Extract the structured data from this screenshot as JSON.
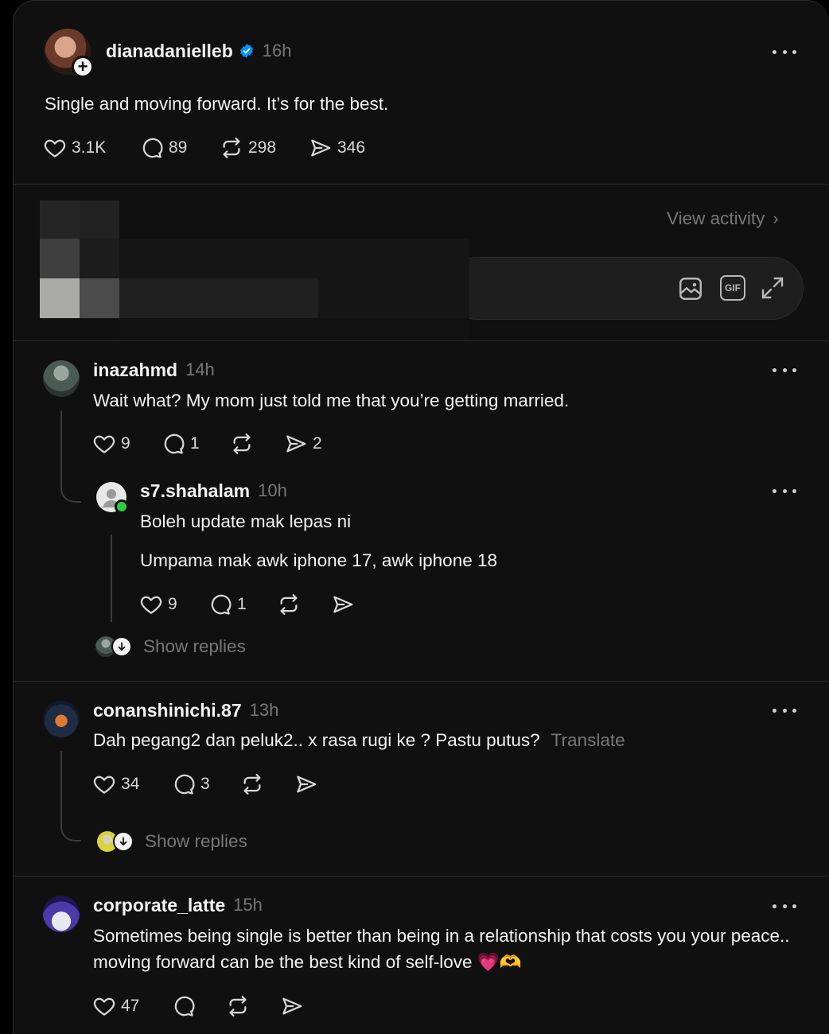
{
  "post": {
    "username": "dianadanielleb",
    "time": "16h",
    "verified": true,
    "text": "Single and moving forward. It’s for the best.",
    "likes": "3.1K",
    "comments": "89",
    "reposts": "298",
    "shares": "346"
  },
  "activity": {
    "view_label": "View activity"
  },
  "composer": {
    "image_icon": "image-icon",
    "gif_label": "GIF",
    "expand_icon": "expand-icon"
  },
  "comments": [
    {
      "username": "inazahmd",
      "time": "14h",
      "text": "Wait what? My mom just told me that you’re getting married.",
      "likes": "9",
      "replies": "1",
      "shares": "2"
    },
    {
      "username": "conanshinichi.87",
      "time": "13h",
      "text": "Dah pegang2 dan peluk2.. x rasa rugi ke ? Pastu putus?",
      "translate": "Translate",
      "likes": "34",
      "replies": "3",
      "show_replies": "Show replies"
    },
    {
      "username": "corporate_latte",
      "time": "15h",
      "text": "Sometimes being single is better than being in a relationship that costs you your peace.. moving forward can be the best kind of self-love 💗🫶",
      "likes": "47"
    }
  ],
  "nested_reply": {
    "username": "s7.shahalam",
    "time": "10h",
    "line1": "Boleh update mak lepas ni",
    "line2": "Umpama mak awk iphone 17, awk iphone 18",
    "likes": "9",
    "replies": "1",
    "show_replies": "Show replies"
  },
  "colors": {
    "background": "#101010",
    "verified_blue": "#0095f6",
    "online_green": "#2ecc40",
    "muted": "#777777"
  }
}
